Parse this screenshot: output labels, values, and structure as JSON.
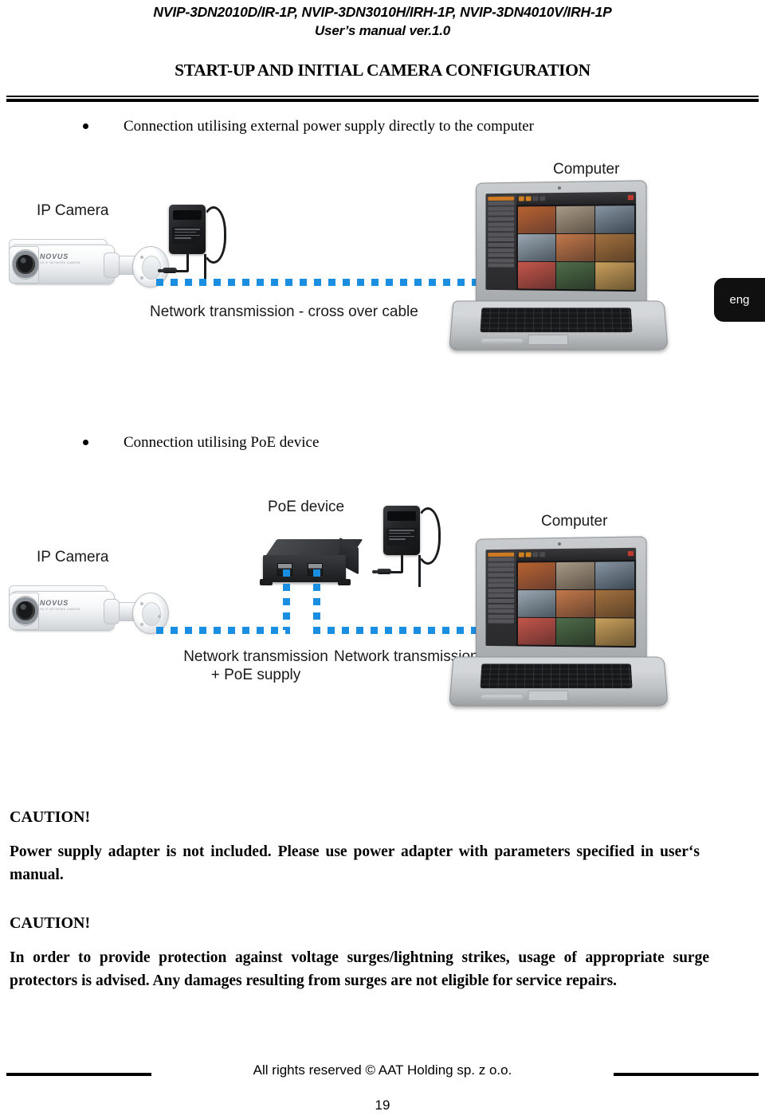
{
  "header": {
    "models": "NVIP-3DN2010D/IR-1P, NVIP-3DN3010H/IRH-1P, NVIP-3DN4010V/IRH-1P",
    "manual_version": "User’s manual ver.1.0"
  },
  "document": {
    "section_title": "START-UP AND INITIAL CAMERA CONFIGURATION"
  },
  "language_tab": {
    "label": "eng"
  },
  "sections": [
    {
      "heading": "Connection utilising external power supply directly to the computer",
      "diagram": {
        "camera_label": "IP Camera",
        "computer_label": "Computer",
        "link_label": "Network transmission - cross over cable",
        "camera_brand": "NOVUS",
        "camera_brand_sub": "HD IP NETWORK CAMERA"
      }
    },
    {
      "heading": "Connection utilising PoE device",
      "diagram": {
        "camera_label": "IP Camera",
        "poe_label": "PoE device",
        "computer_label": "Computer",
        "link_label_left_line1": "Network transmission",
        "link_label_left_line2": "+ PoE supply",
        "link_label_right": "Network transmission",
        "camera_brand": "NOVUS",
        "camera_brand_sub": "HD IP NETWORK CAMERA"
      }
    }
  ],
  "cautions": [
    {
      "title": "CAUTION!",
      "body": "Power supply adapter is not included. Please use power adapter with parameters specified in user‘s manual."
    },
    {
      "title": "CAUTION!",
      "body": "In order to provide protection against voltage surges/lightning strikes, usage of appropriate surge protectors is advised. Any damages resulting from surges are not eligible for service repairs."
    }
  ],
  "footer": {
    "copyright": "All rights reserved © AAT Holding sp. z o.o.",
    "page_number": "19"
  },
  "colors": {
    "network_link": "#1a8ee0",
    "tab_background": "#101010",
    "text": "#000000"
  }
}
